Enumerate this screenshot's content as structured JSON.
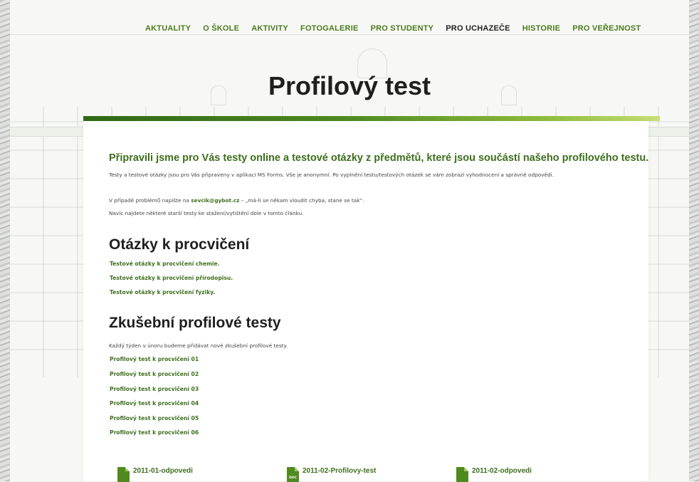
{
  "nav": {
    "items": [
      {
        "label": "AKTUALITY"
      },
      {
        "label": "O ŠKOLE"
      },
      {
        "label": "AKTIVITY"
      },
      {
        "label": "FOTOGALERIE"
      },
      {
        "label": "PRO STUDENTY"
      },
      {
        "label": "PRO UCHAZEČE"
      },
      {
        "label": "HISTORIE"
      },
      {
        "label": "PRO VEŘEJNOST"
      }
    ],
    "active": "PRO UCHAZEČE"
  },
  "page_title": "Profilový test",
  "intro": {
    "heading": "Připravili jsme pro Vás testy online a testové otázky z předmětů, které jsou součástí našeho profilového testu.",
    "para1": "Testy a testové otázky jsou pro Vás připraveny v aplikaci MS Forms. Vše je anonymní. Po vyplnění testu/testových otázek se vám zobrazí vyhodnocení a správné odpovědi.",
    "para2_prefix": "V případě problémů napište na ",
    "email": "sevcik@gybot.cz",
    "para2_suffix": " – „má-li se někam vloudit chyba, stane se tak“.",
    "para3": "Navíc najdete některé starší testy ke stažení/vytištění dole v tomto článku."
  },
  "practice": {
    "heading": "Otázky k procvičení",
    "links": [
      "Testové otázky k procvičení chemie.",
      "Testové otázky k procvičení přírodopisu.",
      "Testové otázky k procvičení fyziky."
    ]
  },
  "tests": {
    "heading": "Zkušební profilové testy",
    "note": "Každý týden v únoru budeme přidávat nové zkušební profilové testy.",
    "links": [
      "Profilový test k procvičení 01",
      "Profilový test k procvičení 02",
      "Profilový test k procvičení 03",
      "Profilový test k procvičení 04",
      "Profilový test k procvičení 05",
      "Profilový test k procvičení 06"
    ]
  },
  "downloads": [
    {
      "name": "2011-01-odpovedi",
      "icon": "file-icon",
      "icon_label": ""
    },
    {
      "name": "2011-02-Profilovy-test",
      "icon": "doc-file-icon",
      "icon_label": "DOC"
    },
    {
      "name": "2011-02-odpovedi",
      "icon": "file-icon",
      "icon_label": ""
    }
  ],
  "colors": {
    "accent": "#3e6f1d",
    "nav_link": "#4b7a1f",
    "bar_start": "#2f6a17",
    "bar_end": "#c7df77"
  }
}
